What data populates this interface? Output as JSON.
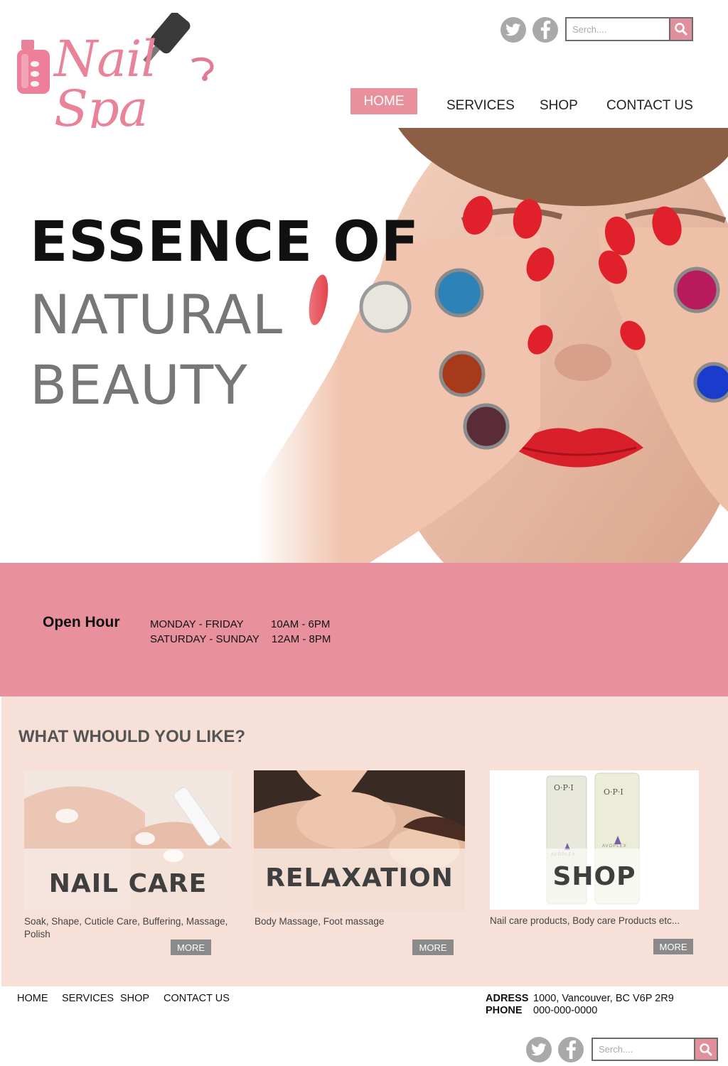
{
  "header": {
    "logo_text": "Nail Spa",
    "social": [
      {
        "icon": "twitter-icon"
      },
      {
        "icon": "facebook-icon"
      }
    ],
    "search": {
      "placeholder": "Serch...."
    },
    "nav": {
      "home": "HOME",
      "services": "SERVICES",
      "shop": "SHOP",
      "contact": "CONTACT US"
    }
  },
  "hero": {
    "line1": "ESSENCE OF",
    "line2": "NATURAL",
    "line3": "BEAUTY"
  },
  "hours": {
    "title": "Open Hour",
    "rows": [
      {
        "days": "MONDAY - FRIDAY",
        "time": "10AM - 6PM"
      },
      {
        "days": "SATURDAY - SUNDAY",
        "time": "12AM - 8PM"
      }
    ]
  },
  "services": {
    "heading": "WHAT WHOULD YOU LIKE?",
    "cards": [
      {
        "title": "NAIL CARE",
        "desc": "Soak, Shape, Cuticle Care,  Buffering, Massage, Polish",
        "more": "MORE"
      },
      {
        "title": "RELAXATION",
        "desc": "Body Massage, Foot massage",
        "more": "MORE"
      },
      {
        "title": "SHOP",
        "desc": "Nail care products, Body care Products etc...",
        "more": "MORE",
        "product_brand": "O·P·I",
        "product_name": "AVOPLEX"
      }
    ]
  },
  "footer": {
    "nav": {
      "home": "HOME",
      "services": "SERVICES",
      "shop": "SHOP",
      "contact": "CONTACT US"
    },
    "address_label": "ADRESS",
    "address_value": "1000, Vancouver, BC V6P 2R9",
    "phone_label": "PHONE",
    "phone_value": "000-000-0000",
    "search": {
      "placeholder": "Serch...."
    }
  },
  "colors": {
    "accent_pink": "#e8919d",
    "section_bg": "#f6e0d8",
    "button_gray": "#8a8a8a",
    "icon_gray": "#a9a9a9"
  }
}
